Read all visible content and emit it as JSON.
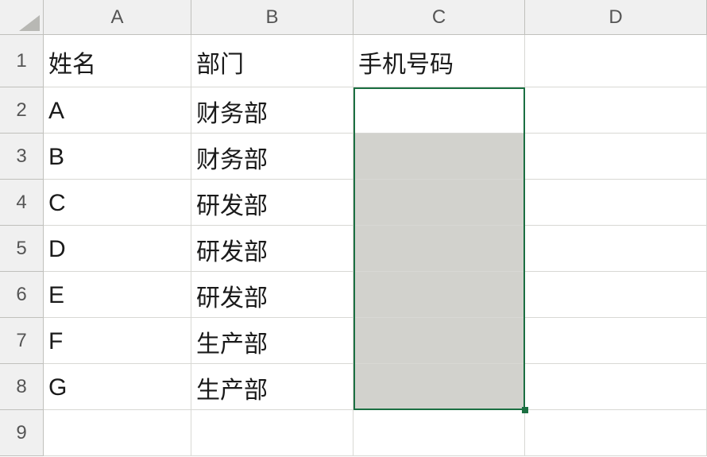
{
  "columns": [
    "A",
    "B",
    "C",
    "D"
  ],
  "rows": [
    "1",
    "2",
    "3",
    "4",
    "5",
    "6",
    "7",
    "8",
    "9"
  ],
  "headers": {
    "A": "姓名",
    "B": "部门",
    "C": "手机号码"
  },
  "data": [
    {
      "A": "A",
      "B": "财务部",
      "C": ""
    },
    {
      "A": "B",
      "B": "财务部",
      "C": ""
    },
    {
      "A": "C",
      "B": "研发部",
      "C": ""
    },
    {
      "A": "D",
      "B": "研发部",
      "C": ""
    },
    {
      "A": "E",
      "B": "研发部",
      "C": ""
    },
    {
      "A": "F",
      "B": "生产部",
      "C": ""
    },
    {
      "A": "G",
      "B": "生产部",
      "C": ""
    }
  ],
  "selection": {
    "col": "C",
    "startRow": 2,
    "endRow": 8,
    "activeRow": 2
  },
  "chart_data": {
    "type": "table",
    "title": "",
    "columns": [
      "姓名",
      "部门",
      "手机号码"
    ],
    "rows": [
      [
        "A",
        "财务部",
        ""
      ],
      [
        "B",
        "财务部",
        ""
      ],
      [
        "C",
        "研发部",
        ""
      ],
      [
        "D",
        "研发部",
        ""
      ],
      [
        "E",
        "研发部",
        ""
      ],
      [
        "F",
        "生产部",
        ""
      ],
      [
        "G",
        "生产部",
        ""
      ]
    ]
  }
}
